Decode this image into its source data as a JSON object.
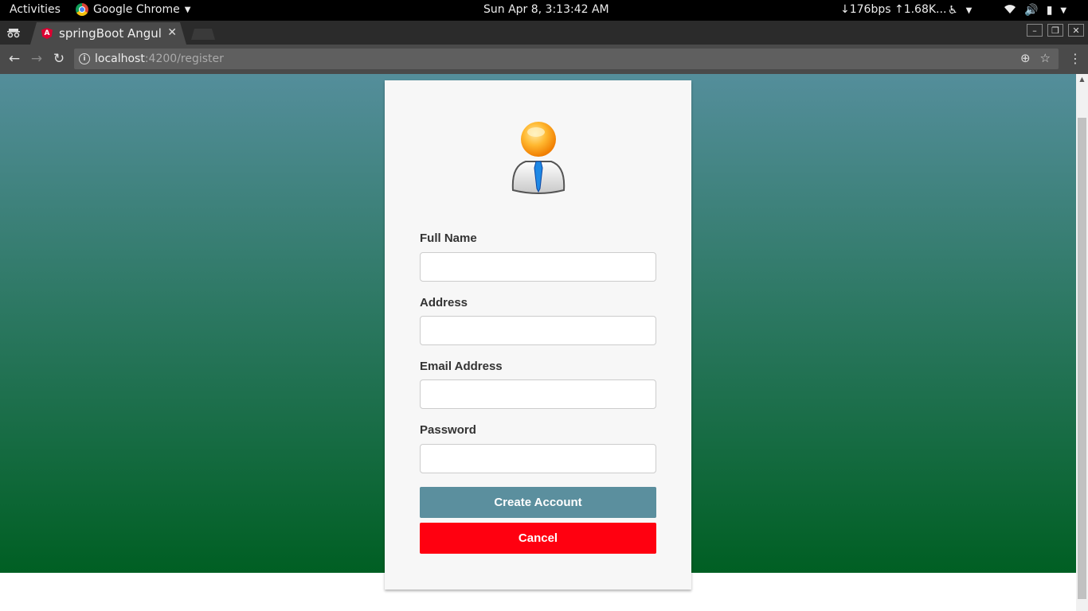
{
  "system_bar": {
    "activities": "Activities",
    "app_name": "Google Chrome",
    "clock": "Sun Apr  8,  3:13:42 AM",
    "network": "↓176bps ↑1.68K..."
  },
  "browser": {
    "tab_title": "springBoot Angular",
    "tab_icon_letter": "A",
    "url_host": "localhost",
    "url_path": ":4200/register"
  },
  "form": {
    "fields": [
      {
        "label": "Full Name",
        "value": ""
      },
      {
        "label": "Address",
        "value": ""
      },
      {
        "label": "Email Address",
        "value": ""
      },
      {
        "label": "Password",
        "value": ""
      }
    ],
    "create_label": "Create Account",
    "cancel_label": "Cancel"
  },
  "colors": {
    "gradient_top": "#548e9b",
    "gradient_bottom": "#005f23",
    "create_button": "#5b8f9e",
    "cancel_button": "#ff0010"
  }
}
